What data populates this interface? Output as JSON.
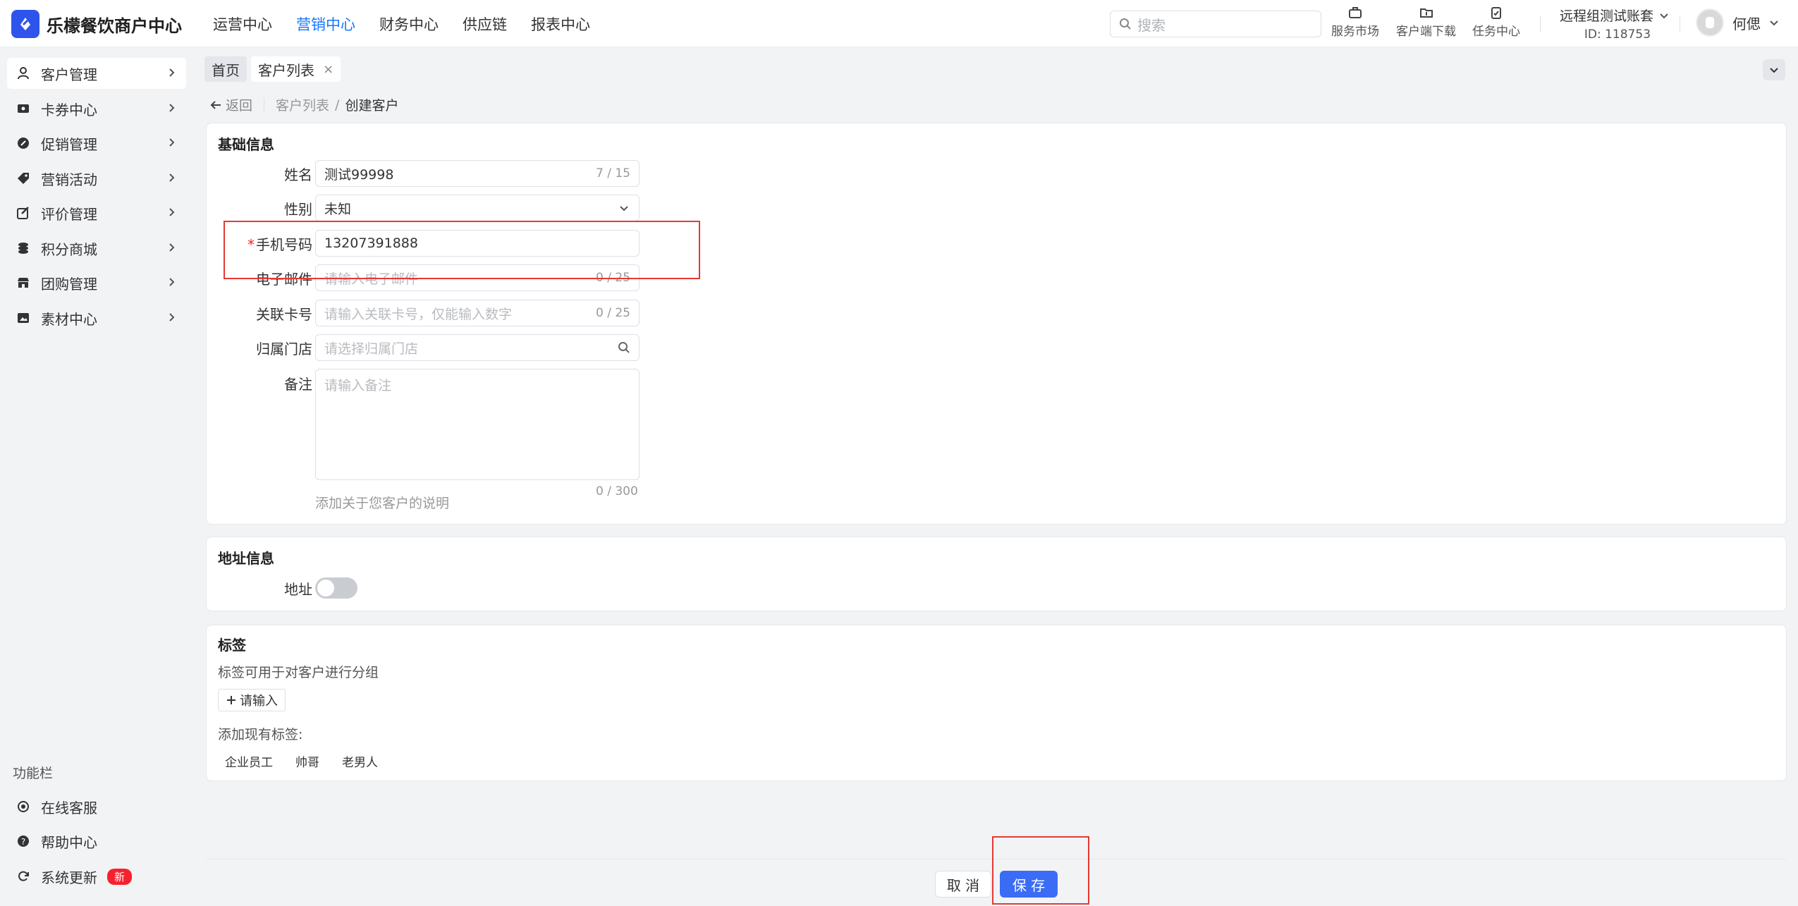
{
  "header": {
    "brand": "乐檬餐饮商户中心",
    "nav": [
      "运营中心",
      "营销中心",
      "财务中心",
      "供应链",
      "报表中心"
    ],
    "nav_active_index": 1,
    "search_placeholder": "搜索",
    "tools": {
      "service_market": "服务市场",
      "client_download": "客户端下载",
      "task_center": "任务中心"
    },
    "account_name": "远程组测试账套",
    "account_id": "ID: 118753",
    "user_name": "何偲"
  },
  "sidebar": {
    "items": [
      {
        "label": "客户管理",
        "icon": "person-icon"
      },
      {
        "label": "卡券中心",
        "icon": "ticket-icon"
      },
      {
        "label": "促销管理",
        "icon": "promo-icon"
      },
      {
        "label": "营销活动",
        "icon": "tag-icon"
      },
      {
        "label": "评价管理",
        "icon": "review-icon"
      },
      {
        "label": "积分商城",
        "icon": "coins-icon"
      },
      {
        "label": "团购管理",
        "icon": "store-icon"
      },
      {
        "label": "素材中心",
        "icon": "image-icon"
      }
    ],
    "section_title": "功能栏",
    "bottom": {
      "online_service": "在线客服",
      "help_center": "帮助中心",
      "system_update": "系统更新",
      "new_badge": "新"
    }
  },
  "tabs": {
    "home": "首页",
    "customer_list": "客户列表",
    "close": "×"
  },
  "breadcrumb": {
    "back": "返回",
    "parent": "客户列表",
    "sep": "/",
    "current": "创建客户"
  },
  "basic": {
    "title": "基础信息",
    "name": {
      "label": "姓名",
      "value": "测试99998",
      "count": "7 / 15"
    },
    "gender": {
      "label": "性别",
      "value": "未知"
    },
    "phone": {
      "label": "手机号码",
      "required_mark": "*",
      "value": "13207391888"
    },
    "email": {
      "label": "电子邮件",
      "placeholder": "请输入电子邮件",
      "count": "0 / 25"
    },
    "card_no": {
      "label": "关联卡号",
      "placeholder": "请输入关联卡号，仅能输入数字",
      "count": "0 / 25"
    },
    "store": {
      "label": "归属门店",
      "placeholder": "请选择归属门店"
    },
    "remark": {
      "label": "备注",
      "placeholder": "请输入备注",
      "hint": "添加关于您客户的说明",
      "count": "0 / 300"
    }
  },
  "address": {
    "title": "地址信息",
    "label": "地址",
    "enabled": false
  },
  "tags": {
    "title": "标签",
    "desc": "标签可用于对客户进行分组",
    "add_label": "请输入",
    "existing_label": "添加现有标签:",
    "existing": [
      "企业员工",
      "帅哥",
      "老男人"
    ]
  },
  "footer": {
    "cancel": "取 消",
    "save": "保 存"
  },
  "colors": {
    "primary": "#3b6cf6",
    "nav_active": "#1677ff",
    "highlight_box": "#e53935",
    "badge": "#f5222d"
  }
}
